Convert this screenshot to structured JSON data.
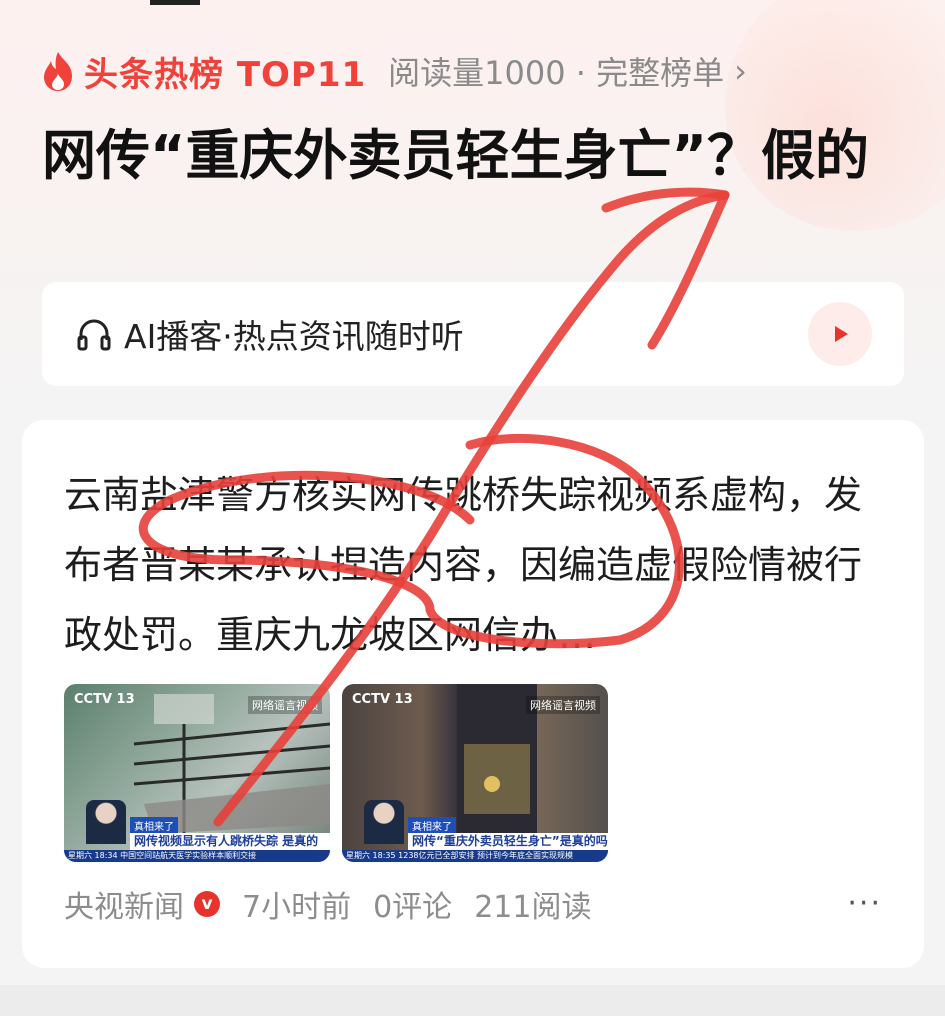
{
  "hot_list": {
    "label": "头条热榜 TOP11",
    "meta": "阅读量1000 · 完整榜单",
    "accent_color": "#f0413a"
  },
  "headline": "网传“重庆外卖员轻生身亡”？假的",
  "podcast": {
    "label": "AI播客·热点资讯随时听",
    "icon": "headphone-icon",
    "play_icon": "play-icon"
  },
  "article": {
    "summary": "云南盐津警方核实网传跳桥失踪视频系虚构，发布者晋某某承认捏造内容，因编造虚假险情被行政处罚。重庆九龙坡区网信办…",
    "thumbnails": [
      {
        "channel": "CCTV 13",
        "tag": "网络谣言视频",
        "lower_tag": "真相来了",
        "lower_title": "网传视频显示有人跳桥失踪 是真的",
        "ticker": "星期六 18:34 中国空间站航天医学实验样本顺利交接"
      },
      {
        "channel": "CCTV 13",
        "tag": "网络谣言视频",
        "lower_tag": "真相来了",
        "lower_title": "网传“重庆外卖员轻生身亡”是真的吗",
        "ticker": "星期六 18:35 1238亿元已全部安排 预计到今年底全面实现规模"
      }
    ],
    "source": "央视新闻",
    "verified_badge": "v",
    "time": "7小时前",
    "comments": "0评论",
    "reads": "211阅读",
    "more_icon": "more-icon"
  },
  "colors": {
    "annotation": "#e8403a",
    "verified": "#e8332d",
    "play_bg": "#fdecea"
  }
}
